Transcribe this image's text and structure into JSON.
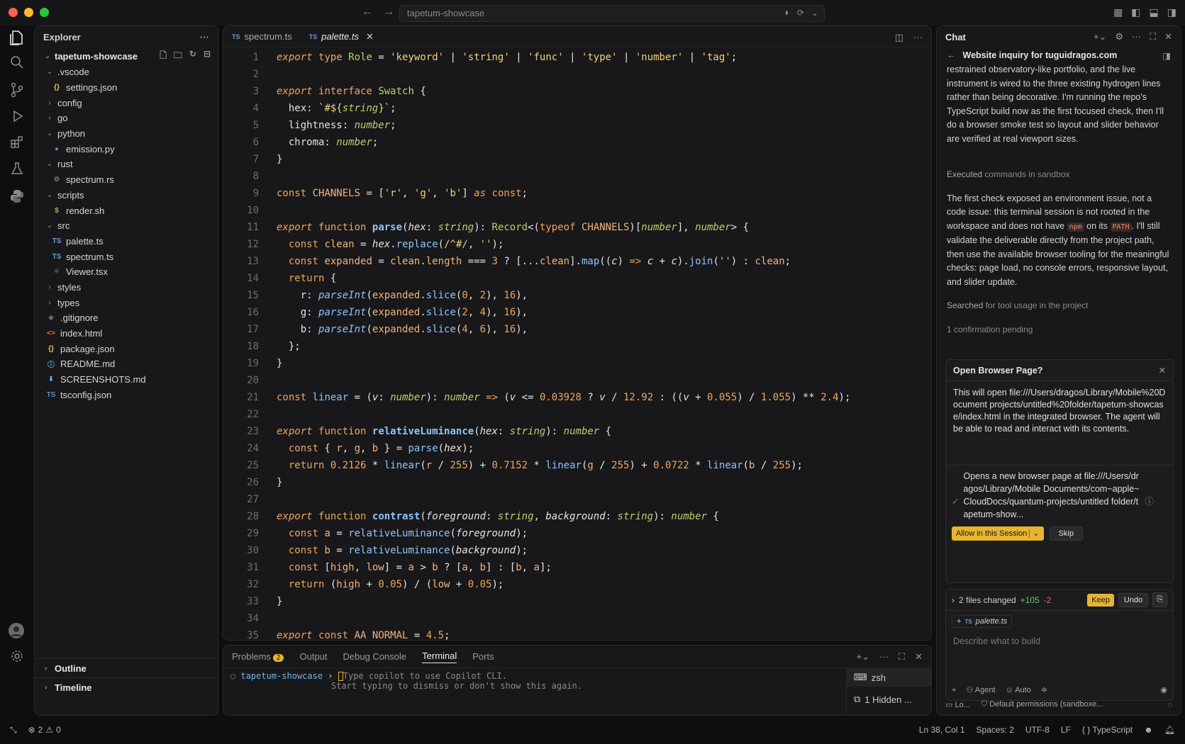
{
  "titlebar": {
    "search": "tapetum-showcase"
  },
  "explorer": {
    "title": "Explorer",
    "root": "tapetum-showcase",
    "items": [
      {
        "label": ".vscode",
        "type": "folder-open",
        "depth": 1
      },
      {
        "label": "settings.json",
        "type": "json",
        "depth": 2
      },
      {
        "label": "config",
        "type": "folder",
        "depth": 1
      },
      {
        "label": "go",
        "type": "folder",
        "depth": 1
      },
      {
        "label": "python",
        "type": "folder-open",
        "depth": 1
      },
      {
        "label": "emission.py",
        "type": "py",
        "depth": 2
      },
      {
        "label": "rust",
        "type": "folder-open",
        "depth": 1
      },
      {
        "label": "spectrum.rs",
        "type": "rs",
        "depth": 2
      },
      {
        "label": "scripts",
        "type": "folder-open",
        "depth": 1
      },
      {
        "label": "render.sh",
        "type": "sh",
        "depth": 2
      },
      {
        "label": "src",
        "type": "folder-open",
        "depth": 1
      },
      {
        "label": "palette.ts",
        "type": "ts",
        "depth": 2
      },
      {
        "label": "spectrum.ts",
        "type": "ts",
        "depth": 2
      },
      {
        "label": "Viewer.tsx",
        "type": "tsx",
        "depth": 2
      },
      {
        "label": "styles",
        "type": "folder",
        "depth": 1
      },
      {
        "label": "types",
        "type": "folder",
        "depth": 1
      },
      {
        "label": ".gitignore",
        "type": "git",
        "depth": 1
      },
      {
        "label": "index.html",
        "type": "html",
        "depth": 1
      },
      {
        "label": "package.json",
        "type": "json",
        "depth": 1
      },
      {
        "label": "README.md",
        "type": "info",
        "depth": 1
      },
      {
        "label": "SCREENSHOTS.md",
        "type": "md",
        "depth": 1
      },
      {
        "label": "tsconfig.json",
        "type": "tsconfig",
        "depth": 1
      }
    ],
    "outline": "Outline",
    "timeline": "Timeline"
  },
  "editor": {
    "tabs": [
      {
        "label": "spectrum.ts",
        "active": false
      },
      {
        "label": "palette.ts",
        "active": true
      }
    ]
  },
  "panel": {
    "tabs": [
      "Problems",
      "Output",
      "Debug Console",
      "Terminal",
      "Ports"
    ],
    "problems_count": "2",
    "terminal_prompt": "tapetum-showcase",
    "terminal_line1": "Type copilot to use Copilot CLI.",
    "terminal_line2": "Start typing to dismiss or don't show this again.",
    "session_name": "zsh",
    "hidden_label": "1 Hidden ..."
  },
  "chat": {
    "header": "Chat",
    "title": "Website inquiry for tuguidragos.com",
    "para1": "restrained observatory-like portfolio, and the live instrument is wired to the three existing hydrogen lines rather than being decorative. I'm running the repo's TypeScript build now as the first focused check, then I'll do a browser smoke test so layout and slider behavior are verified at real viewport sizes.",
    "executed_prefix": "Executed",
    "executed_suffix": "commands in sandbox",
    "para2_a": "The first check exposed an environment issue, not a code issue: this terminal session is not rooted in the workspace and does not have",
    "para2_npm": "npm",
    "para2_b": "on its",
    "para2_path": "PATH",
    "para2_c": ". I'll still validate the deliverable directly from the project path, then use the available browser tooling for the meaningful checks: page load, no console errors, responsive layout, and slider update.",
    "searched_prefix": "Searched",
    "searched_suffix": "for tool usage in the project",
    "pending": "1 confirmation pending",
    "card_title": "Open Browser Page?",
    "card_body": "This will open file:///Users/dragos/Library/Mobile%20Documents/com~apple~CloudDocs/quantum-projects/untitled%20folder/tapetum-showcase/index.html in the integrated browser. The agent will be able to read and interact with its contents.",
    "card_body_display": "This will open file:///Users/dragos/Library/Mobile%20Document projects/untitled%20folder/tapetum-showcase/index.html in the integrated browser. The agent will be able to read and interact with its contents.",
    "card_step": "Opens a new browser page at file:///Users/dragos/Library/Mobile Documents/com~apple~CloudDocs/quantum-projects/untitled folder/tapetum-show...",
    "allow_label": "Allow in this Session",
    "skip_label": "Skip",
    "files_changed": "2 files changed",
    "added": "+105",
    "removed": "-2",
    "keep_label": "Keep",
    "undo_label": "Undo",
    "attached_file": "palette.ts",
    "input_placeholder": "Describe what to build",
    "mode": "Agent",
    "model": "Auto",
    "footer_left": "Lo...",
    "footer_perm": "Default permissions (sandboxe..."
  },
  "status": {
    "errors": "2",
    "warnings": "0",
    "position": "Ln 38, Col 1",
    "spaces": "Spaces: 2",
    "encoding": "UTF-8",
    "eol": "LF",
    "language": "TypeScript"
  },
  "colors": {
    "accent": "#e5b431",
    "background": "#18181a"
  }
}
